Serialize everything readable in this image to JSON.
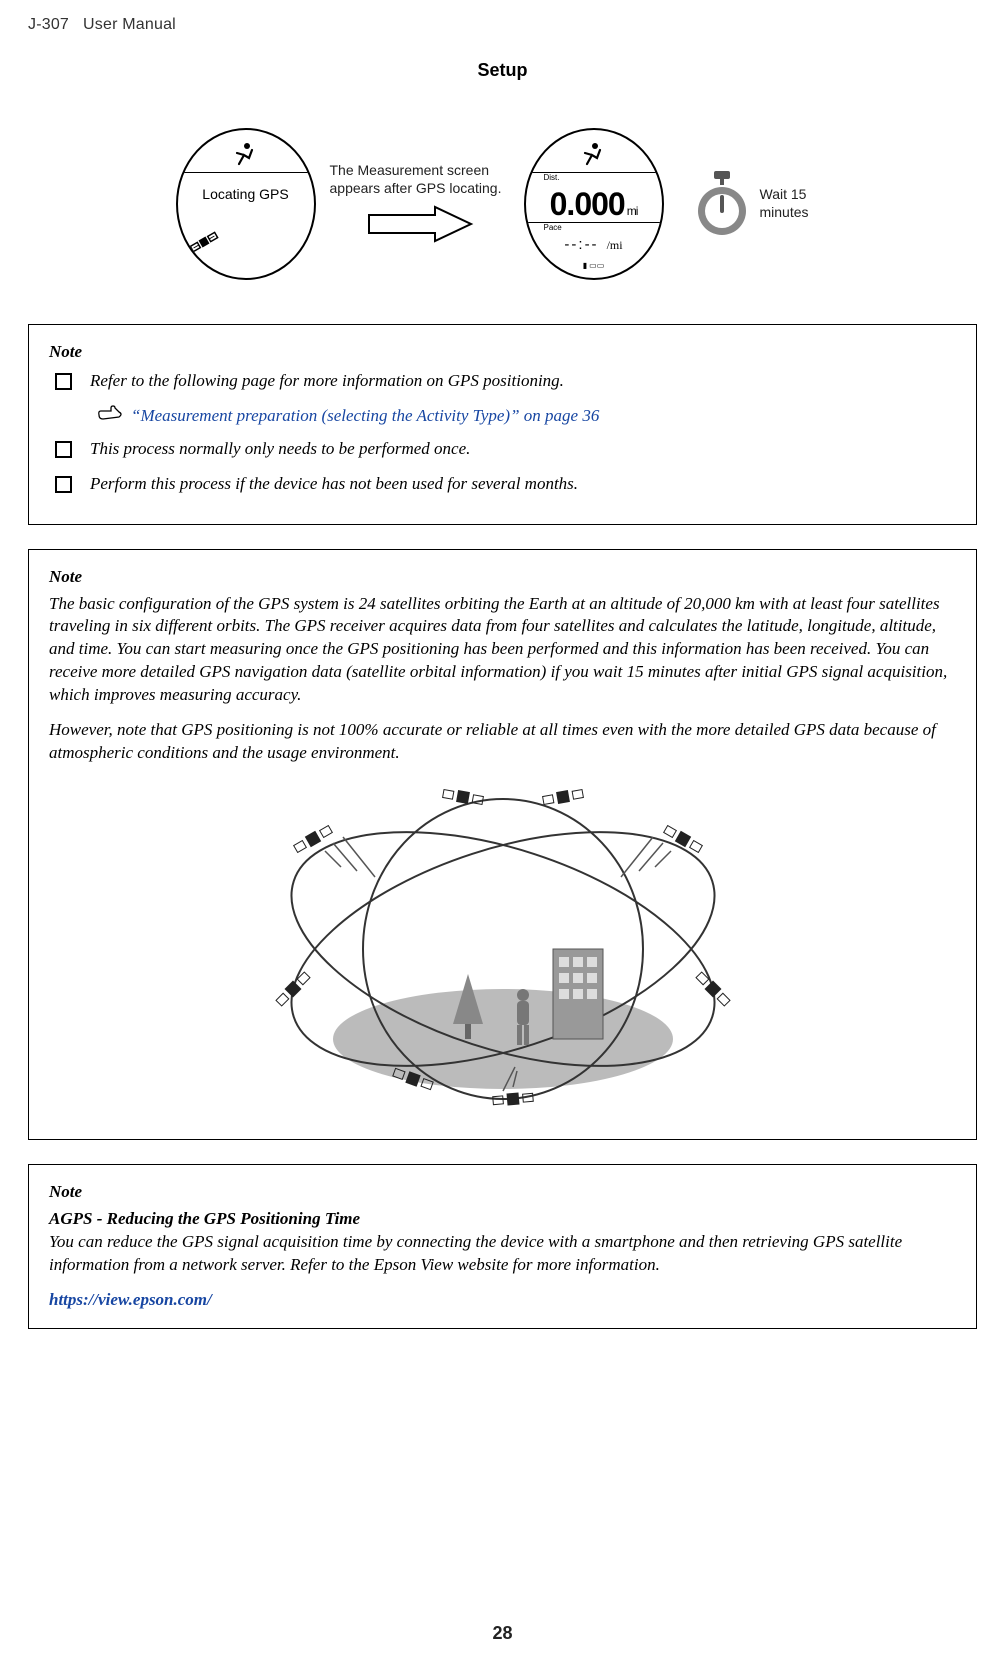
{
  "header": {
    "model": "J-307",
    "doc": "User Manual"
  },
  "section_title": "Setup",
  "transition": {
    "caption": "The Measurement screen appears after GPS locating.",
    "wait_text": "Wait 15 minutes",
    "screen1": {
      "label": "Locating GPS"
    },
    "screen2": {
      "dist_label": "Dist.",
      "dist_value": "0.000",
      "dist_unit": "mi",
      "pace_label": "Pace",
      "pace_value": "--:--",
      "pace_unit": "/mi"
    }
  },
  "note1": {
    "title": "Note",
    "items": [
      "Refer to the following page for more information on GPS positioning.",
      "This process normally only needs to be performed once.",
      "Perform this process if the device has not been used for several months."
    ],
    "xref": "“Measurement preparation (selecting the Activity Type)” on page 36"
  },
  "note2": {
    "title": "Note",
    "para1": "The basic configuration of the GPS system is 24 satellites orbiting the Earth at an altitude of 20,000 km with at least four satellites traveling in six different orbits. The GPS receiver acquires data from four satellites and calculates the latitude, longitude, altitude, and time. You can start measuring once the GPS positioning has been performed and this information has been received. You can receive more detailed GPS navigation data (satellite orbital information) if you wait 15 minutes after initial GPS signal acquisition, which improves measuring accuracy.",
    "para2": "However, note that GPS positioning is not 100% accurate or reliable at all times even with the more detailed GPS data because of atmospheric conditions and the usage environment."
  },
  "note3": {
    "title": "Note",
    "subtitle": "AGPS - Reducing the GPS Positioning Time",
    "body": "You can reduce the GPS signal acquisition time by connecting the device with a smartphone and then retrieving GPS satellite information from a network server. Refer to the Epson View website for more information.",
    "url": "https://view.epson.com/"
  },
  "page_number": "28"
}
